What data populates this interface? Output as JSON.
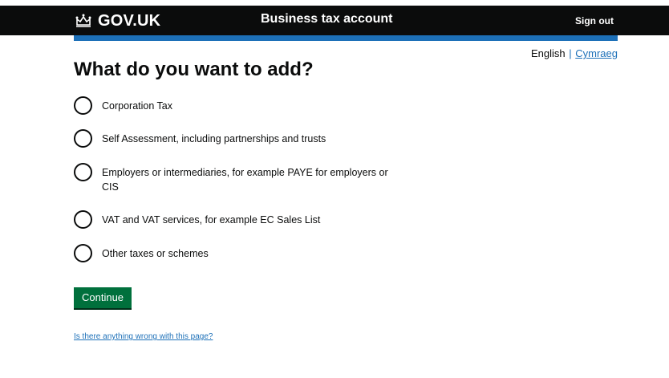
{
  "header": {
    "logo_text": "GOV.UK",
    "service_name": "Business tax account",
    "sign_out": "Sign out"
  },
  "language": {
    "current": "English",
    "separator": "|",
    "other": "Cymraeg"
  },
  "page": {
    "title": "What do you want to add?"
  },
  "options": [
    {
      "label": "Corporation Tax"
    },
    {
      "label": "Self Assessment, including partnerships and trusts"
    },
    {
      "label": "Employers or intermediaries, for example PAYE for employers or CIS"
    },
    {
      "label": "VAT and VAT services, for example EC Sales List"
    },
    {
      "label": "Other taxes or schemes"
    }
  ],
  "actions": {
    "continue_label": "Continue"
  },
  "footer": {
    "problem_link": "Is there anything wrong with this page?"
  },
  "colors": {
    "header_bg": "#0b0c0c",
    "brand_blue": "#1d70b8",
    "button_green": "#00703c"
  }
}
